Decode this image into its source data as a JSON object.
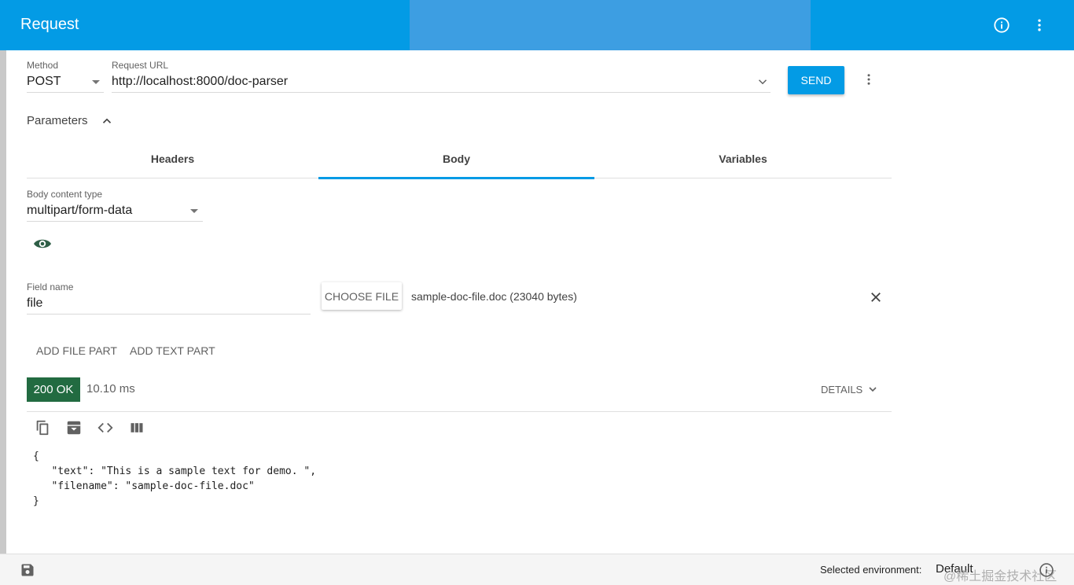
{
  "appbar": {
    "title": "Request",
    "info_icon": "info-icon",
    "menu_icon": "more-vert-icon"
  },
  "request": {
    "method_label": "Method",
    "method_value": "POST",
    "url_label": "Request URL",
    "url_value": "http://localhost:8000/doc-parser",
    "send_label": "SEND"
  },
  "parameters": {
    "title": "Parameters",
    "tabs": [
      {
        "label": "Headers"
      },
      {
        "label": "Body",
        "selected": true
      },
      {
        "label": "Variables"
      }
    ]
  },
  "body": {
    "content_type_label": "Body content type",
    "content_type_value": "multipart/form-data",
    "field_name_label": "Field name",
    "field_name_value": "file",
    "choose_file_label": "CHOOSE FILE",
    "file_info": "sample-doc-file.doc (23040 bytes)",
    "add_file_part": "ADD FILE PART",
    "add_text_part": "ADD TEXT PART"
  },
  "response": {
    "status": "200 OK",
    "time": "10.10 ms",
    "details_label": "DETAILS",
    "json_lines": [
      "{",
      "   \"text\": \"This is a sample text for demo. \",",
      "   \"filename\": \"sample-doc-file.doc\"",
      "}"
    ]
  },
  "footer": {
    "env_label": "Selected environment:",
    "env_value": "Default",
    "watermark": "@稀土掘金技术社区"
  },
  "colors": {
    "accent": "#039be5",
    "status_ok": "#226b41"
  }
}
